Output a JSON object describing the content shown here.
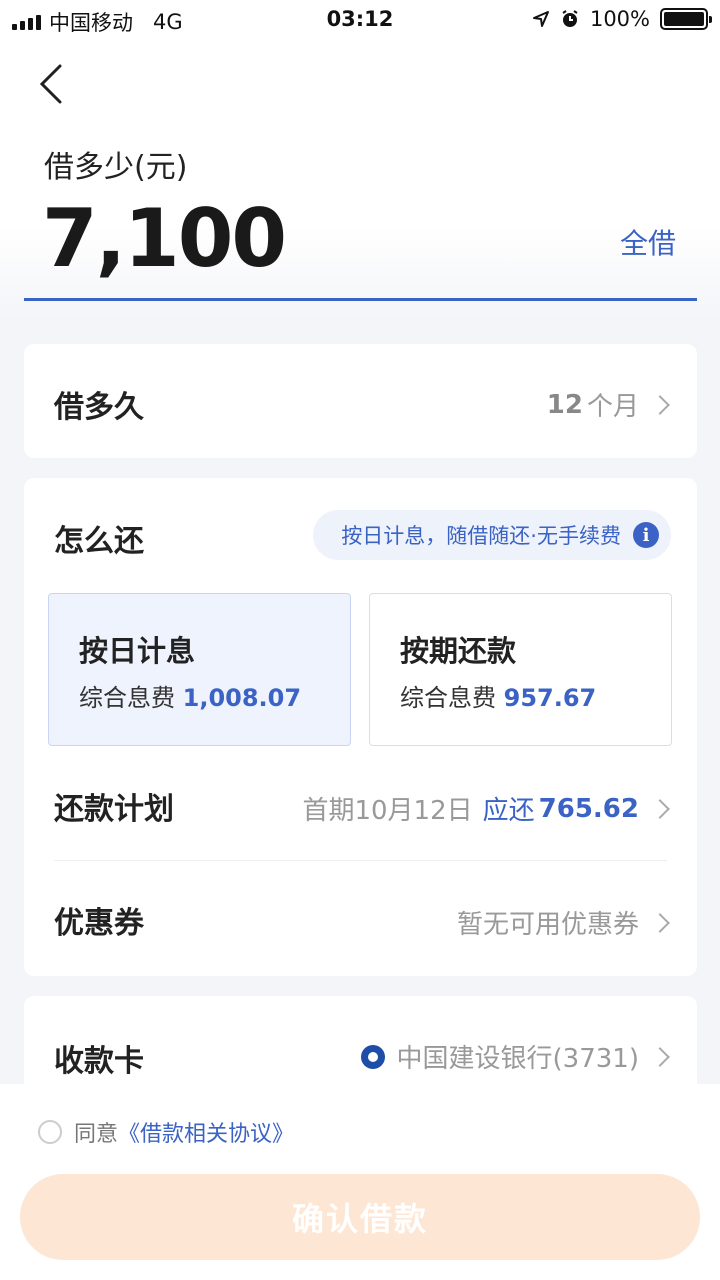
{
  "status_bar": {
    "carrier": "中国移动",
    "network": "4G",
    "time": "03:12",
    "battery": "100%"
  },
  "amount": {
    "label": "借多少(元)",
    "value": "7,100",
    "borrow_all": "全借"
  },
  "duration": {
    "label": "借多久",
    "value_num": "12",
    "value_unit": "个月"
  },
  "repayment": {
    "label": "怎么还",
    "tag": "按日计息，随借随还·无手续费",
    "options": [
      {
        "title": "按日计息",
        "fee_label": "综合息费",
        "fee": "1,008.07",
        "selected": true
      },
      {
        "title": "按期还款",
        "fee_label": "综合息费",
        "fee": "957.67",
        "selected": false
      }
    ],
    "plan_label": "还款计划",
    "plan_first": "首期10月12日",
    "plan_due_label": "应还",
    "plan_due": "765.62",
    "coupon_label": "优惠券",
    "coupon_value": "暂无可用优惠券"
  },
  "bank": {
    "label": "收款卡",
    "card": "中国建设银行(3731)"
  },
  "agreement": {
    "prefix": "同意",
    "link": "《借款相关协议》"
  },
  "confirm_button": "确认借款",
  "colors": {
    "accent": "#3b63c5",
    "button_disabled": "#fde6d4"
  }
}
